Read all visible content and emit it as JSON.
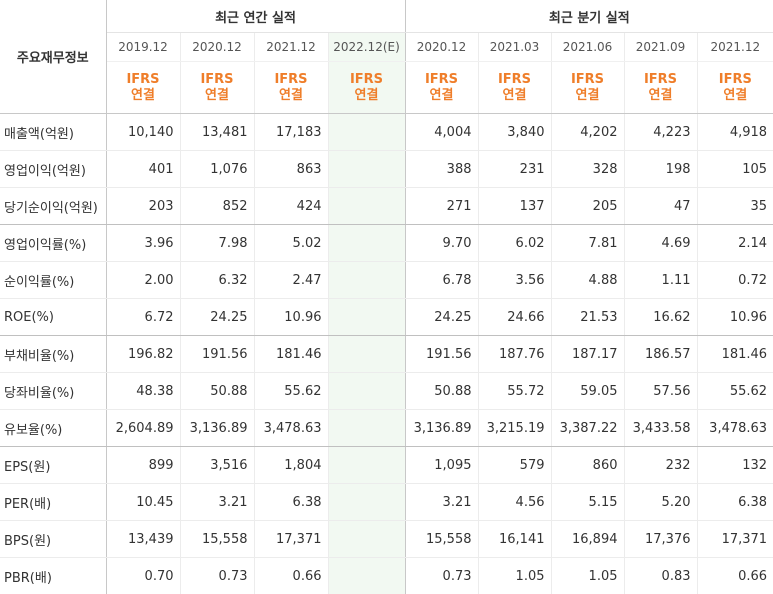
{
  "table": {
    "row_header_label": "주요재무정보",
    "groups": [
      {
        "label": "최근 연간 실적"
      },
      {
        "label": "최근 분기 실적"
      }
    ],
    "periods": [
      "2019.12",
      "2020.12",
      "2021.12",
      "2022.12(E)",
      "2020.12",
      "2021.03",
      "2021.06",
      "2021.09",
      "2021.12"
    ],
    "standards": [
      "IFRS",
      "IFRS",
      "IFRS",
      "IFRS",
      "IFRS",
      "IFRS",
      "IFRS",
      "IFRS",
      "IFRS"
    ],
    "consolidations": [
      "연결",
      "연결",
      "연결",
      "연결",
      "연결",
      "연결",
      "연결",
      "연결",
      "연결"
    ],
    "rows": [
      {
        "label": "매출액(억원)",
        "values": [
          "10,140",
          "13,481",
          "17,183",
          "",
          "4,004",
          "3,840",
          "4,202",
          "4,223",
          "4,918"
        ]
      },
      {
        "label": "영업이익(억원)",
        "values": [
          "401",
          "1,076",
          "863",
          "",
          "388",
          "231",
          "328",
          "198",
          "105"
        ]
      },
      {
        "label": "당기순이익(억원)",
        "values": [
          "203",
          "852",
          "424",
          "",
          "271",
          "137",
          "205",
          "47",
          "35"
        ]
      },
      {
        "label": "영업이익률(%)",
        "values": [
          "3.96",
          "7.98",
          "5.02",
          "",
          "9.70",
          "6.02",
          "7.81",
          "4.69",
          "2.14"
        ]
      },
      {
        "label": "순이익률(%)",
        "values": [
          "2.00",
          "6.32",
          "2.47",
          "",
          "6.78",
          "3.56",
          "4.88",
          "1.11",
          "0.72"
        ]
      },
      {
        "label": "ROE(%)",
        "values": [
          "6.72",
          "24.25",
          "10.96",
          "",
          "24.25",
          "24.66",
          "21.53",
          "16.62",
          "10.96"
        ]
      },
      {
        "label": "부채비율(%)",
        "values": [
          "196.82",
          "191.56",
          "181.46",
          "",
          "191.56",
          "187.76",
          "187.17",
          "186.57",
          "181.46"
        ]
      },
      {
        "label": "당좌비율(%)",
        "values": [
          "48.38",
          "50.88",
          "55.62",
          "",
          "50.88",
          "55.72",
          "59.05",
          "57.56",
          "55.62"
        ]
      },
      {
        "label": "유보율(%)",
        "values": [
          "2,604.89",
          "3,136.89",
          "3,478.63",
          "",
          "3,136.89",
          "3,215.19",
          "3,387.22",
          "3,433.58",
          "3,478.63"
        ]
      },
      {
        "label": "EPS(원)",
        "values": [
          "899",
          "3,516",
          "1,804",
          "",
          "1,095",
          "579",
          "860",
          "232",
          "132"
        ]
      },
      {
        "label": "PER(배)",
        "values": [
          "10.45",
          "3.21",
          "6.38",
          "",
          "3.21",
          "4.56",
          "5.15",
          "5.20",
          "6.38"
        ]
      },
      {
        "label": "BPS(원)",
        "values": [
          "13,439",
          "15,558",
          "17,371",
          "",
          "15,558",
          "16,141",
          "16,894",
          "17,376",
          "17,371"
        ]
      },
      {
        "label": "PBR(배)",
        "values": [
          "0.70",
          "0.73",
          "0.66",
          "",
          "0.73",
          "1.05",
          "1.05",
          "0.83",
          "0.66"
        ]
      }
    ]
  }
}
